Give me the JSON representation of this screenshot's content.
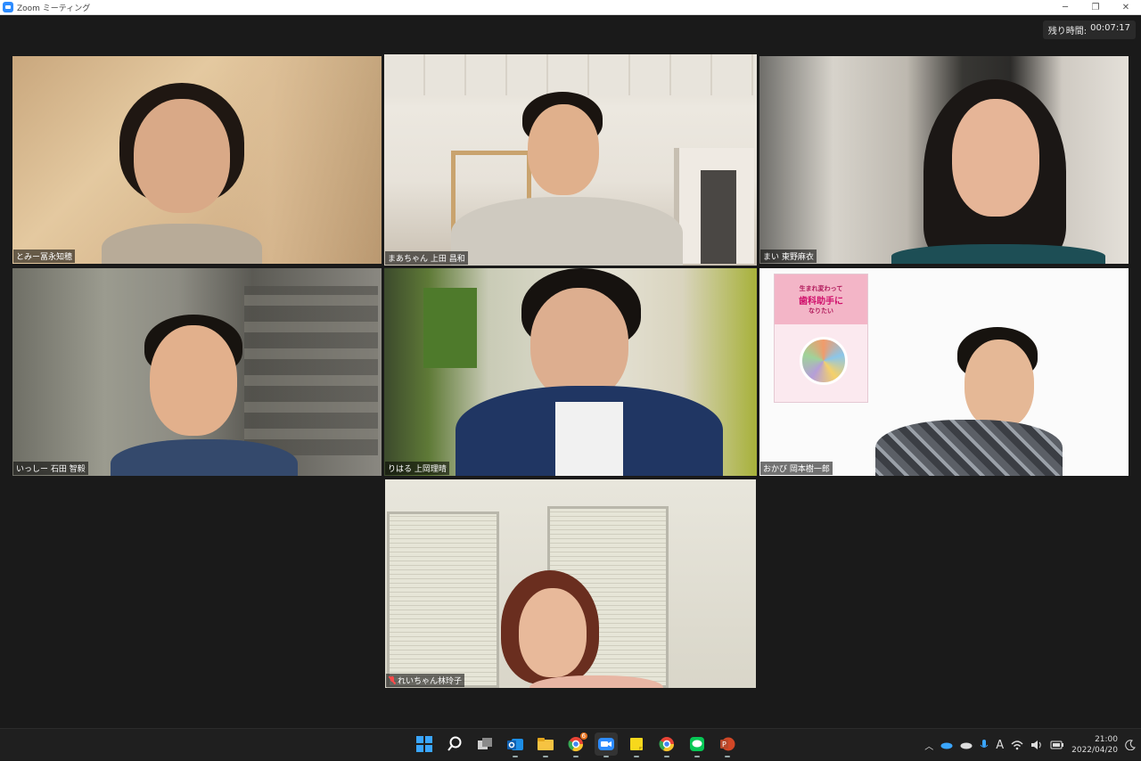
{
  "window": {
    "title": "Zoom ミーティング",
    "controls": [
      "─",
      "❐",
      "✕"
    ]
  },
  "timer": {
    "label": "残り時間:",
    "value": "00:07:17"
  },
  "participants": [
    {
      "name": "とみー冨永知穂",
      "speaking": false
    },
    {
      "name": "まあちゃん 上田 昌和",
      "speaking": true
    },
    {
      "name": "まい 東野麻衣",
      "speaking": false
    },
    {
      "name": "いっしー 石田 智毅",
      "speaking": false
    },
    {
      "name": "りはる 上岡理晴",
      "speaking": false
    },
    {
      "name": "おかび 岡本樹一郎",
      "speaking": false
    },
    {
      "name": "れいちゃん林玲子",
      "speaking": false,
      "muted": true
    }
  ],
  "book": {
    "line1": "生まれ変わって",
    "line2": "歯科助手に",
    "line3": "なりたい"
  },
  "taskbar": {
    "apps": [
      "windows-start",
      "search",
      "task-view",
      "outlook",
      "file-explorer",
      "chrome",
      "zoom",
      "sticky-notes",
      "chrome-profile",
      "line",
      "powerpoint"
    ],
    "chrome_badge": "6",
    "tray_lang": "A"
  },
  "clock": {
    "time": "21:00",
    "date": "2022/04/20"
  },
  "colors": {
    "speaker_outline": "#c9f14a",
    "stage_bg": "#1a1a1a",
    "zoom_blue": "#2d8cff"
  }
}
